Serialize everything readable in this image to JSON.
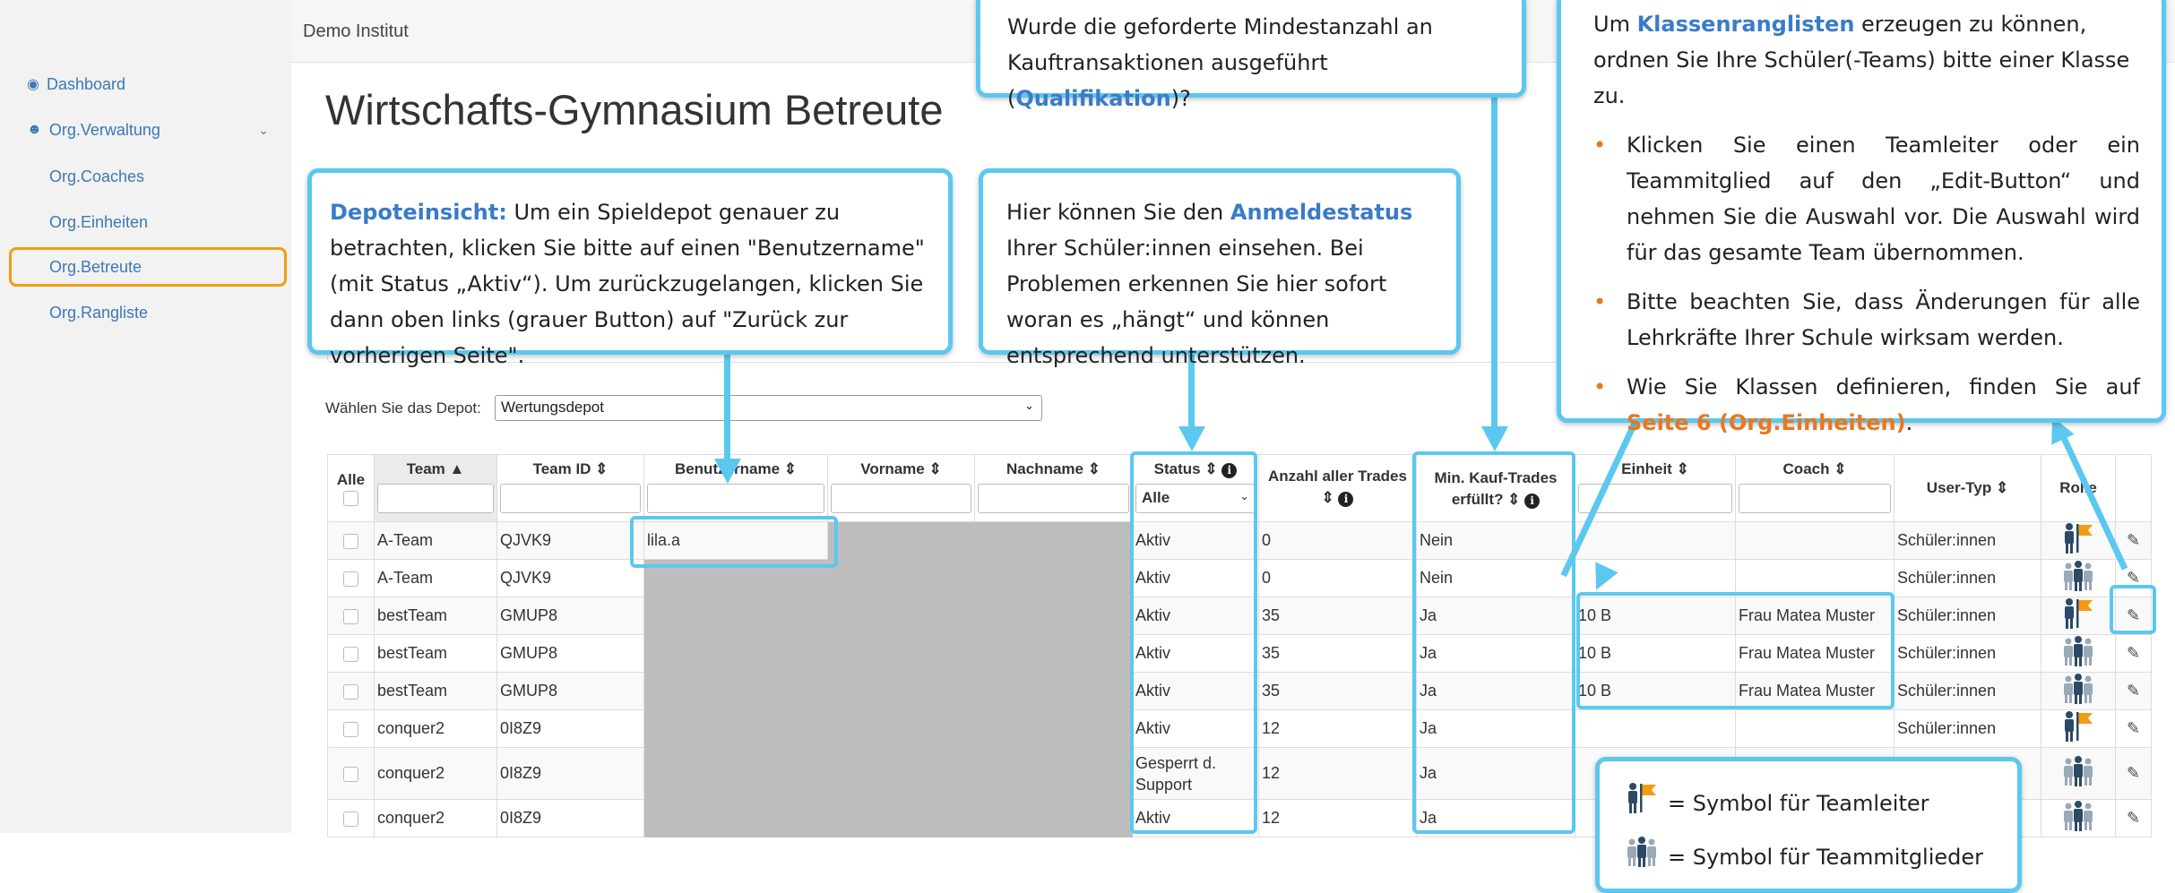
{
  "topbar": {
    "title": "Demo Institut"
  },
  "sidebar": {
    "items": [
      {
        "label": "Dashboard",
        "icon": "dashboard-icon"
      },
      {
        "label": "Org.Verwaltung",
        "icon": "users-icon"
      },
      {
        "label": "Org.Coaches"
      },
      {
        "label": "Org.Einheiten"
      },
      {
        "label": "Org.Betreute"
      },
      {
        "label": "Org.Rangliste"
      }
    ]
  },
  "page": {
    "title": "Wirtschafts-Gymnasium Betreute",
    "depot_label": "Wählen Sie das Depot:",
    "depot_value": "Wertungsdepot"
  },
  "table": {
    "headers": {
      "alle": "Alle",
      "team": "Team ▲",
      "team_id": "Team ID ⇕",
      "benutzername": "Benutzername ⇕",
      "vorname": "Vorname ⇕",
      "nachname": "Nachname ⇕",
      "status": "Status ⇕",
      "status_filter": "Alle",
      "trades": "Anzahl aller Trades ⇕",
      "kauf_trades": "Min. Kauf-Trades erfüllt? ⇕",
      "einheit": "Einheit ⇕",
      "coach": "Coach ⇕",
      "user_typ": "User-Typ ⇕",
      "rolle": "Rolle"
    },
    "rows": [
      {
        "team": "A-Team",
        "team_id": "QJVK9",
        "benutzername": "lila.a",
        "status": "Aktiv",
        "trades": "0",
        "kauf": "Nein",
        "einheit": "",
        "coach": "",
        "user_typ": "Schüler:innen",
        "role": "leader"
      },
      {
        "team": "A-Team",
        "team_id": "QJVK9",
        "benutzername": "",
        "status": "Aktiv",
        "trades": "0",
        "kauf": "Nein",
        "einheit": "",
        "coach": "",
        "user_typ": "Schüler:innen",
        "role": "member"
      },
      {
        "team": "bestTeam",
        "team_id": "GMUP8",
        "benutzername": "",
        "status": "Aktiv",
        "trades": "35",
        "kauf": "Ja",
        "einheit": "10 B",
        "coach": "Frau Matea Muster",
        "user_typ": "Schüler:innen",
        "role": "leader"
      },
      {
        "team": "bestTeam",
        "team_id": "GMUP8",
        "benutzername": "",
        "status": "Aktiv",
        "trades": "35",
        "kauf": "Ja",
        "einheit": "10 B",
        "coach": "Frau Matea Muster",
        "user_typ": "Schüler:innen",
        "role": "member"
      },
      {
        "team": "bestTeam",
        "team_id": "GMUP8",
        "benutzername": "",
        "status": "Aktiv",
        "trades": "35",
        "kauf": "Ja",
        "einheit": "10 B",
        "coach": "Frau Matea Muster",
        "user_typ": "Schüler:innen",
        "role": "member"
      },
      {
        "team": "conquer2",
        "team_id": "0I8Z9",
        "benutzername": "",
        "status": "Aktiv",
        "trades": "12",
        "kauf": "Ja",
        "einheit": "",
        "coach": "",
        "user_typ": "Schüler:innen",
        "role": "leader"
      },
      {
        "team": "conquer2",
        "team_id": "0I8Z9",
        "benutzername": "",
        "status": "Gesperrt d. Support",
        "trades": "12",
        "kauf": "Ja",
        "einheit": "",
        "coach": "",
        "user_typ": "",
        "role": "member"
      },
      {
        "team": "conquer2",
        "team_id": "0I8Z9",
        "benutzername": "",
        "status": "Aktiv",
        "trades": "12",
        "kauf": "Ja",
        "einheit": "",
        "coach": "",
        "user_typ": "",
        "role": "member"
      }
    ]
  },
  "callouts": {
    "depot": {
      "bold": "Depoteinsicht:",
      "text": " Um ein Spieldepot genauer zu betrachten, klicken Sie bitte auf einen \"Benutzername\" (mit Status „Aktiv“). Um zurückzugelangen, klicken Sie dann oben links (grauer Button) auf \"Zurück zur vorherigen Seite\"."
    },
    "status": {
      "pre": "Hier können Sie den ",
      "bold": "Anmeldestatus",
      "text": " Ihrer Schüler:innen einsehen. Bei Problemen erkennen Sie hier sofort woran es „hängt“ und können entsprechend unterstützen."
    },
    "qualifikation": {
      "pre": "Wurde die geforderte Mindestanzahl an Kauftransaktionen ausgeführt (",
      "bold": "Qualifikation",
      "post": ")?"
    },
    "klassen": {
      "pre": "Um ",
      "bold": "Klassenranglisten",
      "post": " erzeugen zu können, ordnen Sie Ihre Schüler(-Teams) bitte einer Klasse zu.",
      "b1": "Klicken Sie einen Teamleiter oder ein Teammitglied auf den „Edit-Button“ und nehmen Sie die Auswahl vor. Die Auswahl wird für das gesamte Team übernommen.",
      "b2": "Bitte beachten Sie, dass Änderungen für alle Lehrkräfte Ihrer Schule wirksam werden.",
      "b3_pre": "Wie Sie Klassen definieren, finden Sie auf ",
      "b3_bold": "Seite 6 (Org.Einheiten)",
      "b3_post": "."
    },
    "legend": {
      "leader": "= Symbol für Teamleiter",
      "member": "= Symbol für Teammitglieder"
    }
  },
  "colors": {
    "accent": "#5bc8ef",
    "orange": "#f39c12",
    "link": "#3c78b5"
  }
}
